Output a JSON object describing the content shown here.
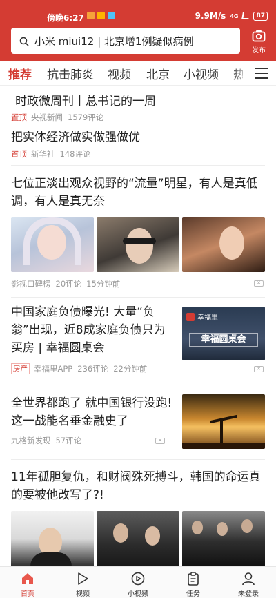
{
  "status_bar": {
    "time": "傍晚6:27",
    "network_speed": "9.9M/s",
    "network_type": "4G",
    "battery": "87"
  },
  "search": {
    "query": "小米 miui12 | 北京增1例疑似病例"
  },
  "publish": {
    "label": "发布"
  },
  "tabs": [
    "推荐",
    "抗击肺炎",
    "视频",
    "北京",
    "小视频",
    "热"
  ],
  "feed": {
    "items": [
      {
        "title": "时政微周刊丨总书记的一周",
        "tag": "置顶",
        "source": "央视新闻",
        "comments": "1579评论"
      },
      {
        "title": "把实体经济做实做强做优",
        "tag": "置顶",
        "source": "新华社",
        "comments": "148评论"
      },
      {
        "title": "七位正淡出观众视野的“流量”明星，有人是真低调，有人是真无奈",
        "source": "影视口碑榜",
        "comments": "20评论",
        "time": "15分钟前"
      },
      {
        "title": "中国家庭负债曝光! 大量“负翁”出现，近8成家庭负债只为买房 | 幸福圆桌会",
        "tag": "房产",
        "source": "幸福里APP",
        "comments": "236评论",
        "time": "22分钟前",
        "thumb_logo": "幸福里",
        "thumb_caption": "幸福圆桌会"
      },
      {
        "title": "全世界都跑了 就中国银行没跑! 这一战能名垂金融史了",
        "source": "九格新发现",
        "comments": "57评论"
      },
      {
        "title": "11年孤胆复仇，和财阀殊死搏斗，韩国的命运真的要被他改写了?!"
      }
    ]
  },
  "bottom_nav": [
    {
      "label": "首页",
      "icon": "home-icon"
    },
    {
      "label": "视频",
      "icon": "play-icon"
    },
    {
      "label": "小视频",
      "icon": "short-video-icon"
    },
    {
      "label": "任务",
      "icon": "task-icon"
    },
    {
      "label": "未登录",
      "icon": "user-icon"
    }
  ],
  "colors": {
    "brand": "#d43c33"
  }
}
